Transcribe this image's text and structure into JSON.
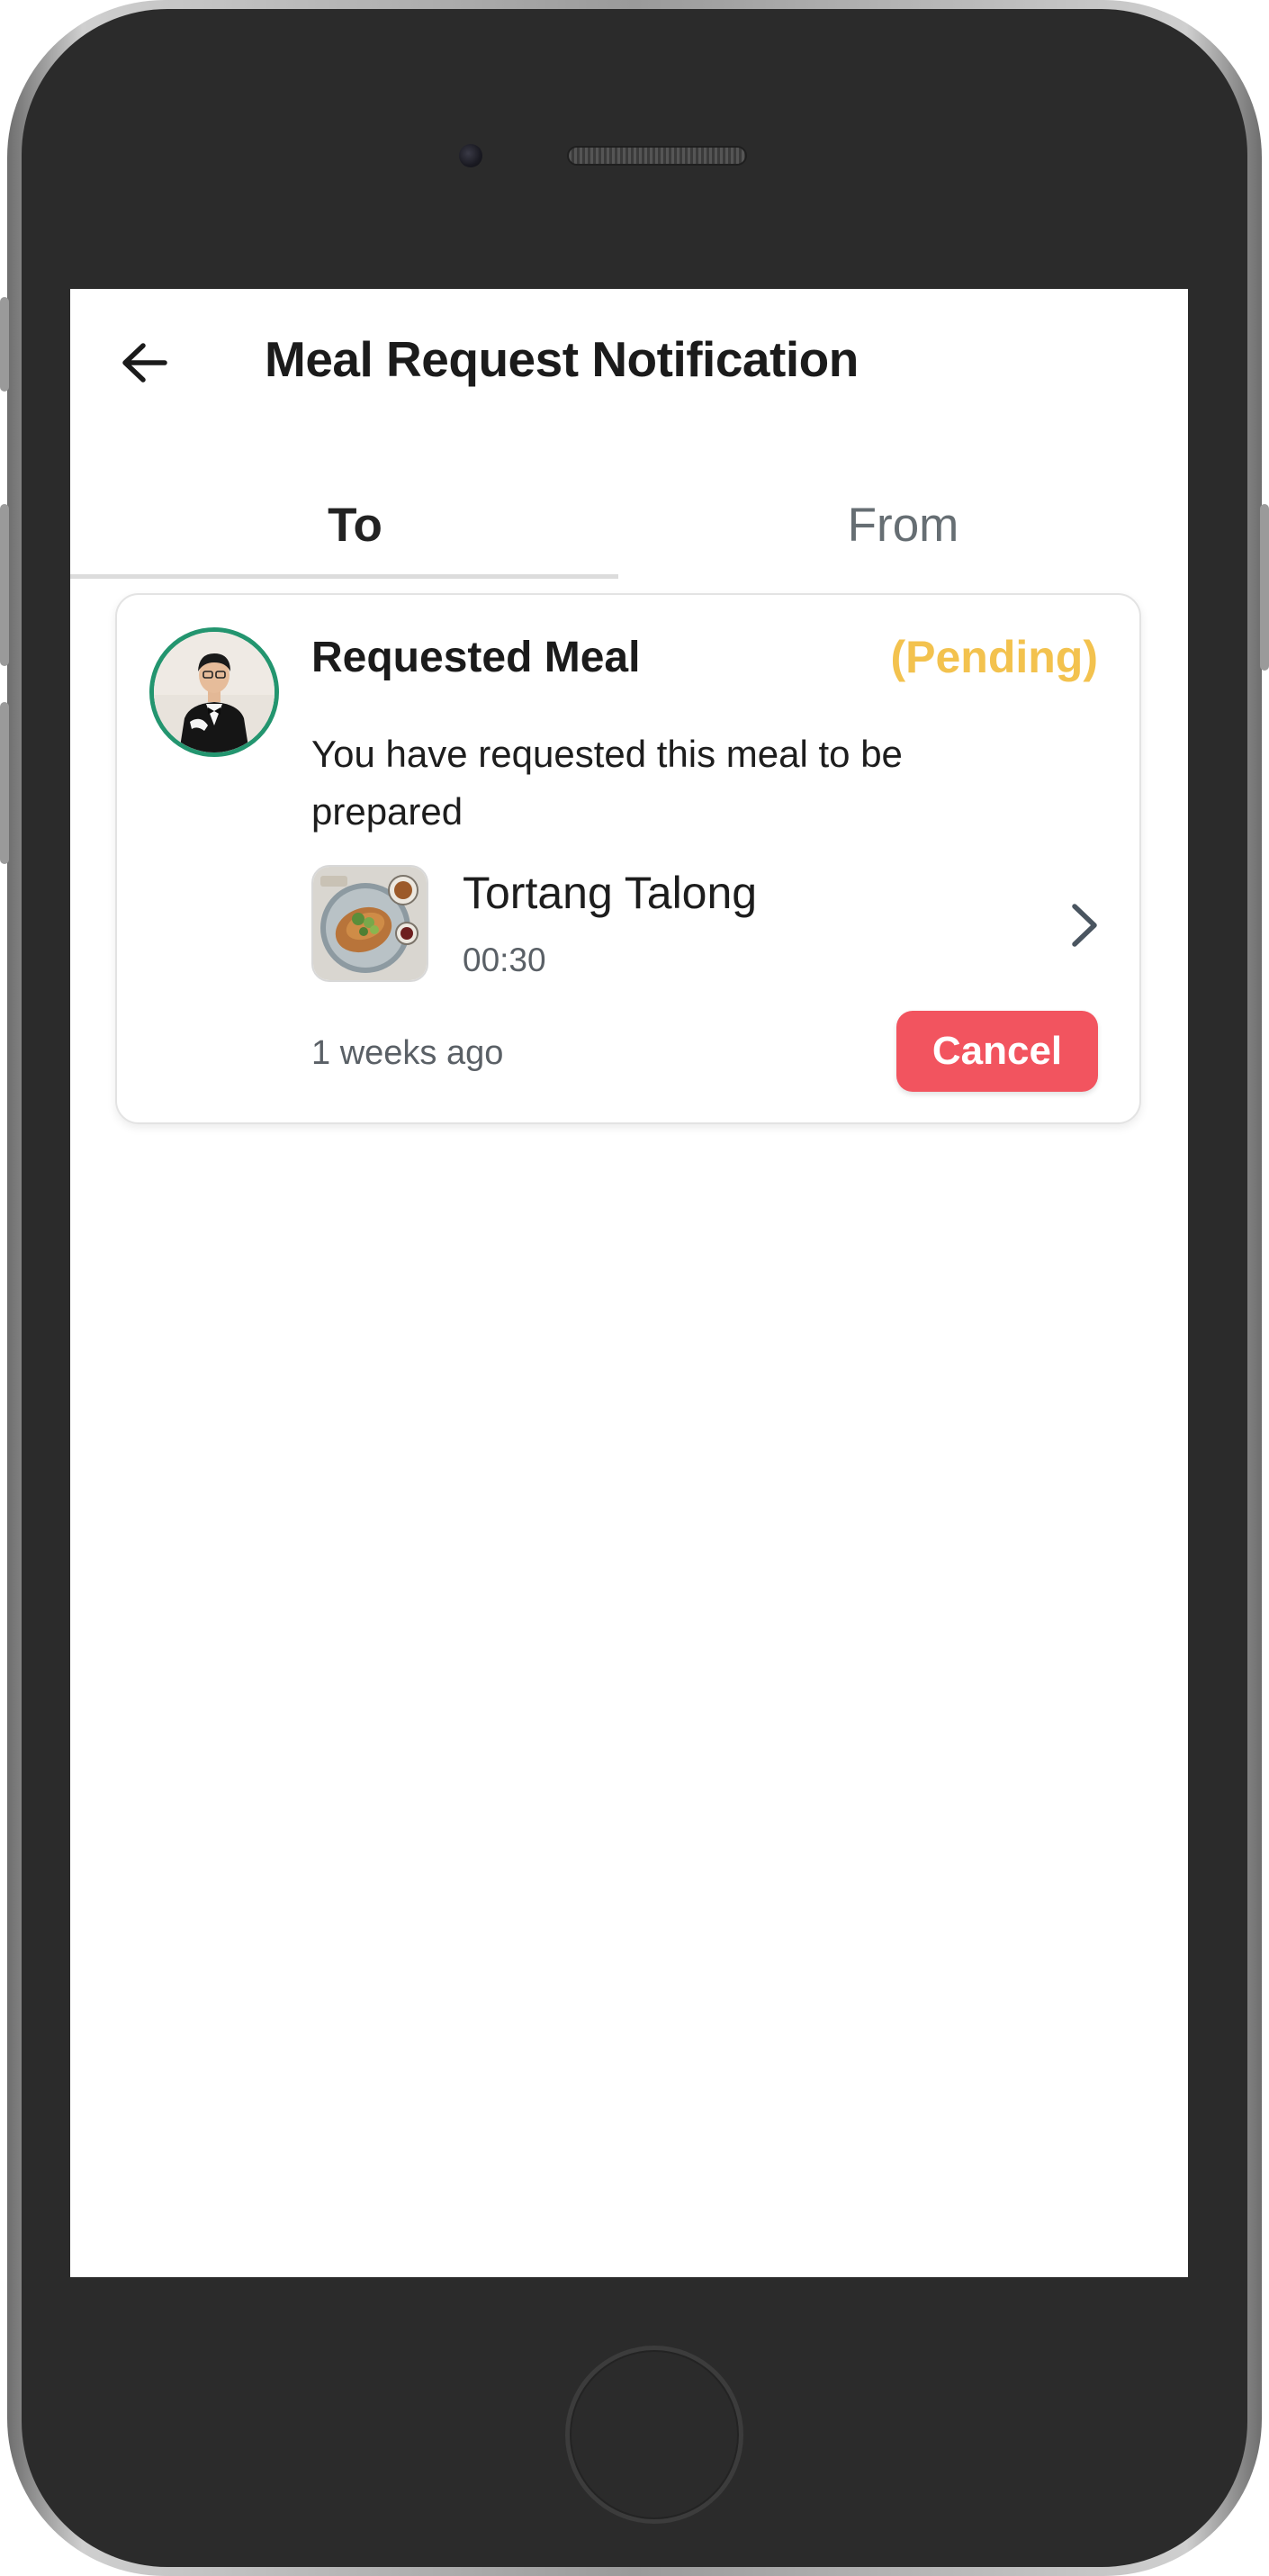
{
  "header": {
    "title": "Meal Request Notification",
    "back_icon": "arrow-left-icon"
  },
  "tabs": [
    {
      "label": "To",
      "active": true
    },
    {
      "label": "From",
      "active": false
    }
  ],
  "notification": {
    "avatar_icon": "user-avatar",
    "title": "Requested Meal",
    "status": "(Pending)",
    "status_color": "#f3c24e",
    "message": "You have requested this meal to be prepared",
    "meal": {
      "name": "Tortang Talong",
      "time": "00:30",
      "thumbnail_icon": "food-plate-icon"
    },
    "timestamp": "1 weeks ago",
    "cancel_label": "Cancel",
    "cancel_color": "#f2545f"
  },
  "colors": {
    "avatar_ring": "#23956f",
    "frame_dark": "#2b2b2b"
  }
}
